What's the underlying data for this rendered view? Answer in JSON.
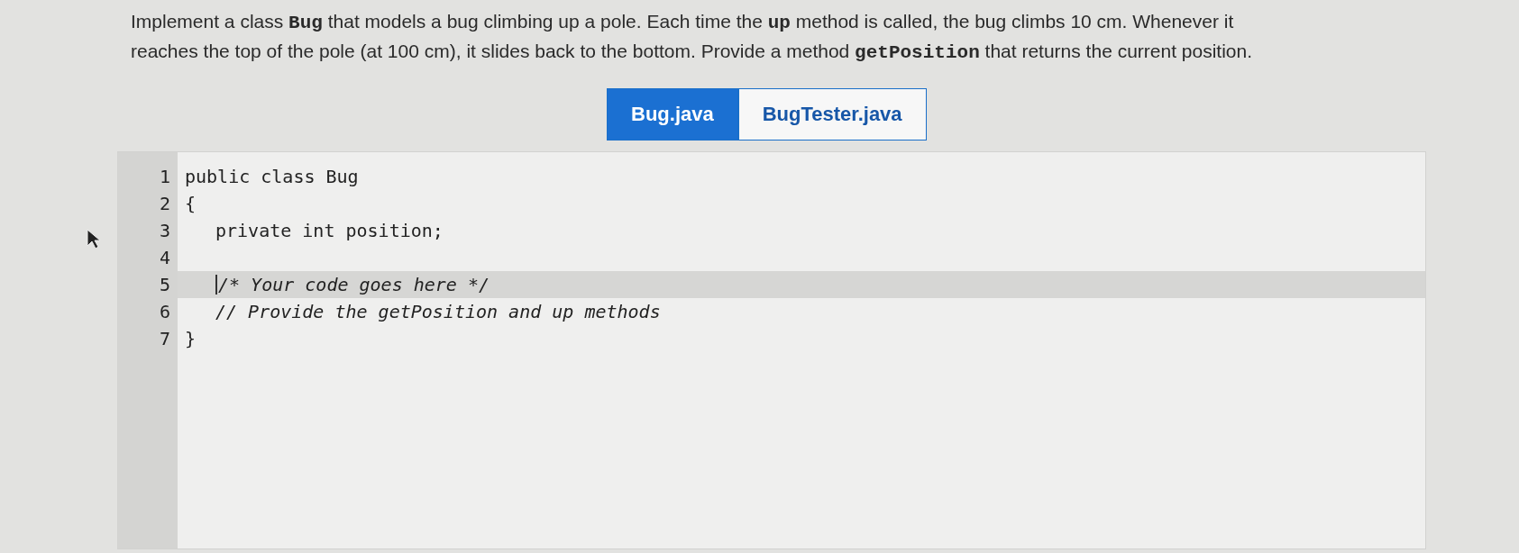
{
  "prompt": "Implement a class **Bug** that models a bug climbing up a pole. Each time the **up** method is called, the bug climbs 10 cm. Whenever it reaches the top of the pole (at 100 cm), it slides back to the bottom. Provide a method **getPosition** that returns the current position.",
  "tabs": [
    {
      "label": "Bug.java",
      "selected": true
    },
    {
      "label": "BugTester.java",
      "selected": false
    }
  ],
  "editor": {
    "lines": [
      {
        "number": "1",
        "text": "public class Bug",
        "kind": "code",
        "indented": false,
        "highlighted": false
      },
      {
        "number": "2",
        "text": "{",
        "kind": "code",
        "indented": false,
        "highlighted": false
      },
      {
        "number": "3",
        "text": "private int position;",
        "kind": "code",
        "indented": true,
        "highlighted": false
      },
      {
        "number": "4",
        "kind": "code",
        "indented": false,
        "highlighted": false
      },
      {
        "number": "5",
        "text": "/* Your code goes here */",
        "kind": "comment",
        "indented": true,
        "highlighted": true
      },
      {
        "number": "6",
        "text": "// Provide the getPosition and up methods",
        "kind": "comment",
        "indented": true,
        "highlighted": false
      },
      {
        "number": "7",
        "text": "}",
        "kind": "code",
        "indented": false,
        "highlighted": false
      }
    ]
  }
}
